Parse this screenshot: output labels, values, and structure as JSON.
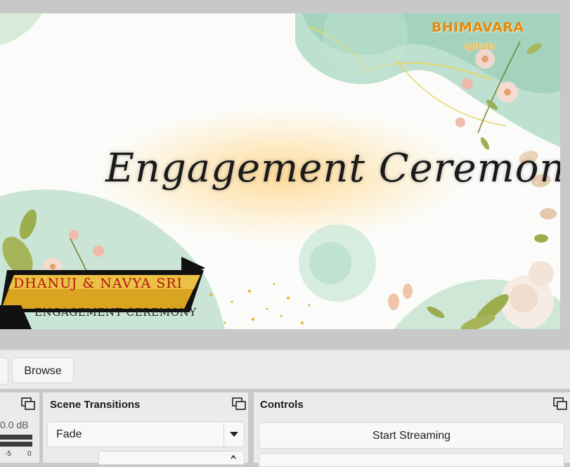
{
  "preview": {
    "title": "Engagement Ceremony",
    "logo_main": "BHIMAVARA",
    "logo_sub": "igitals",
    "banner_names": "DHANUJ & NAVYA SRI",
    "banner_event": "ENGAGEMENT CEREMONY"
  },
  "source_toolbar": {
    "browse_label": "Browse"
  },
  "audio_mixer": {
    "volume_readout": "0.0 dB",
    "tick_neg5": "-5",
    "tick_0": "0"
  },
  "scene_transitions": {
    "title": "Scene Transitions",
    "selected_transition": "Fade"
  },
  "controls": {
    "title": "Controls",
    "start_streaming_label": "Start Streaming"
  },
  "colors": {
    "panel_bg": "#ebebeb",
    "window_bg": "#c8c8c8",
    "button_bg": "#f8f8f8",
    "banner_name_red": "#b3150f",
    "banner_gold": "#d9a521",
    "logo_orange": "#e08a12"
  }
}
